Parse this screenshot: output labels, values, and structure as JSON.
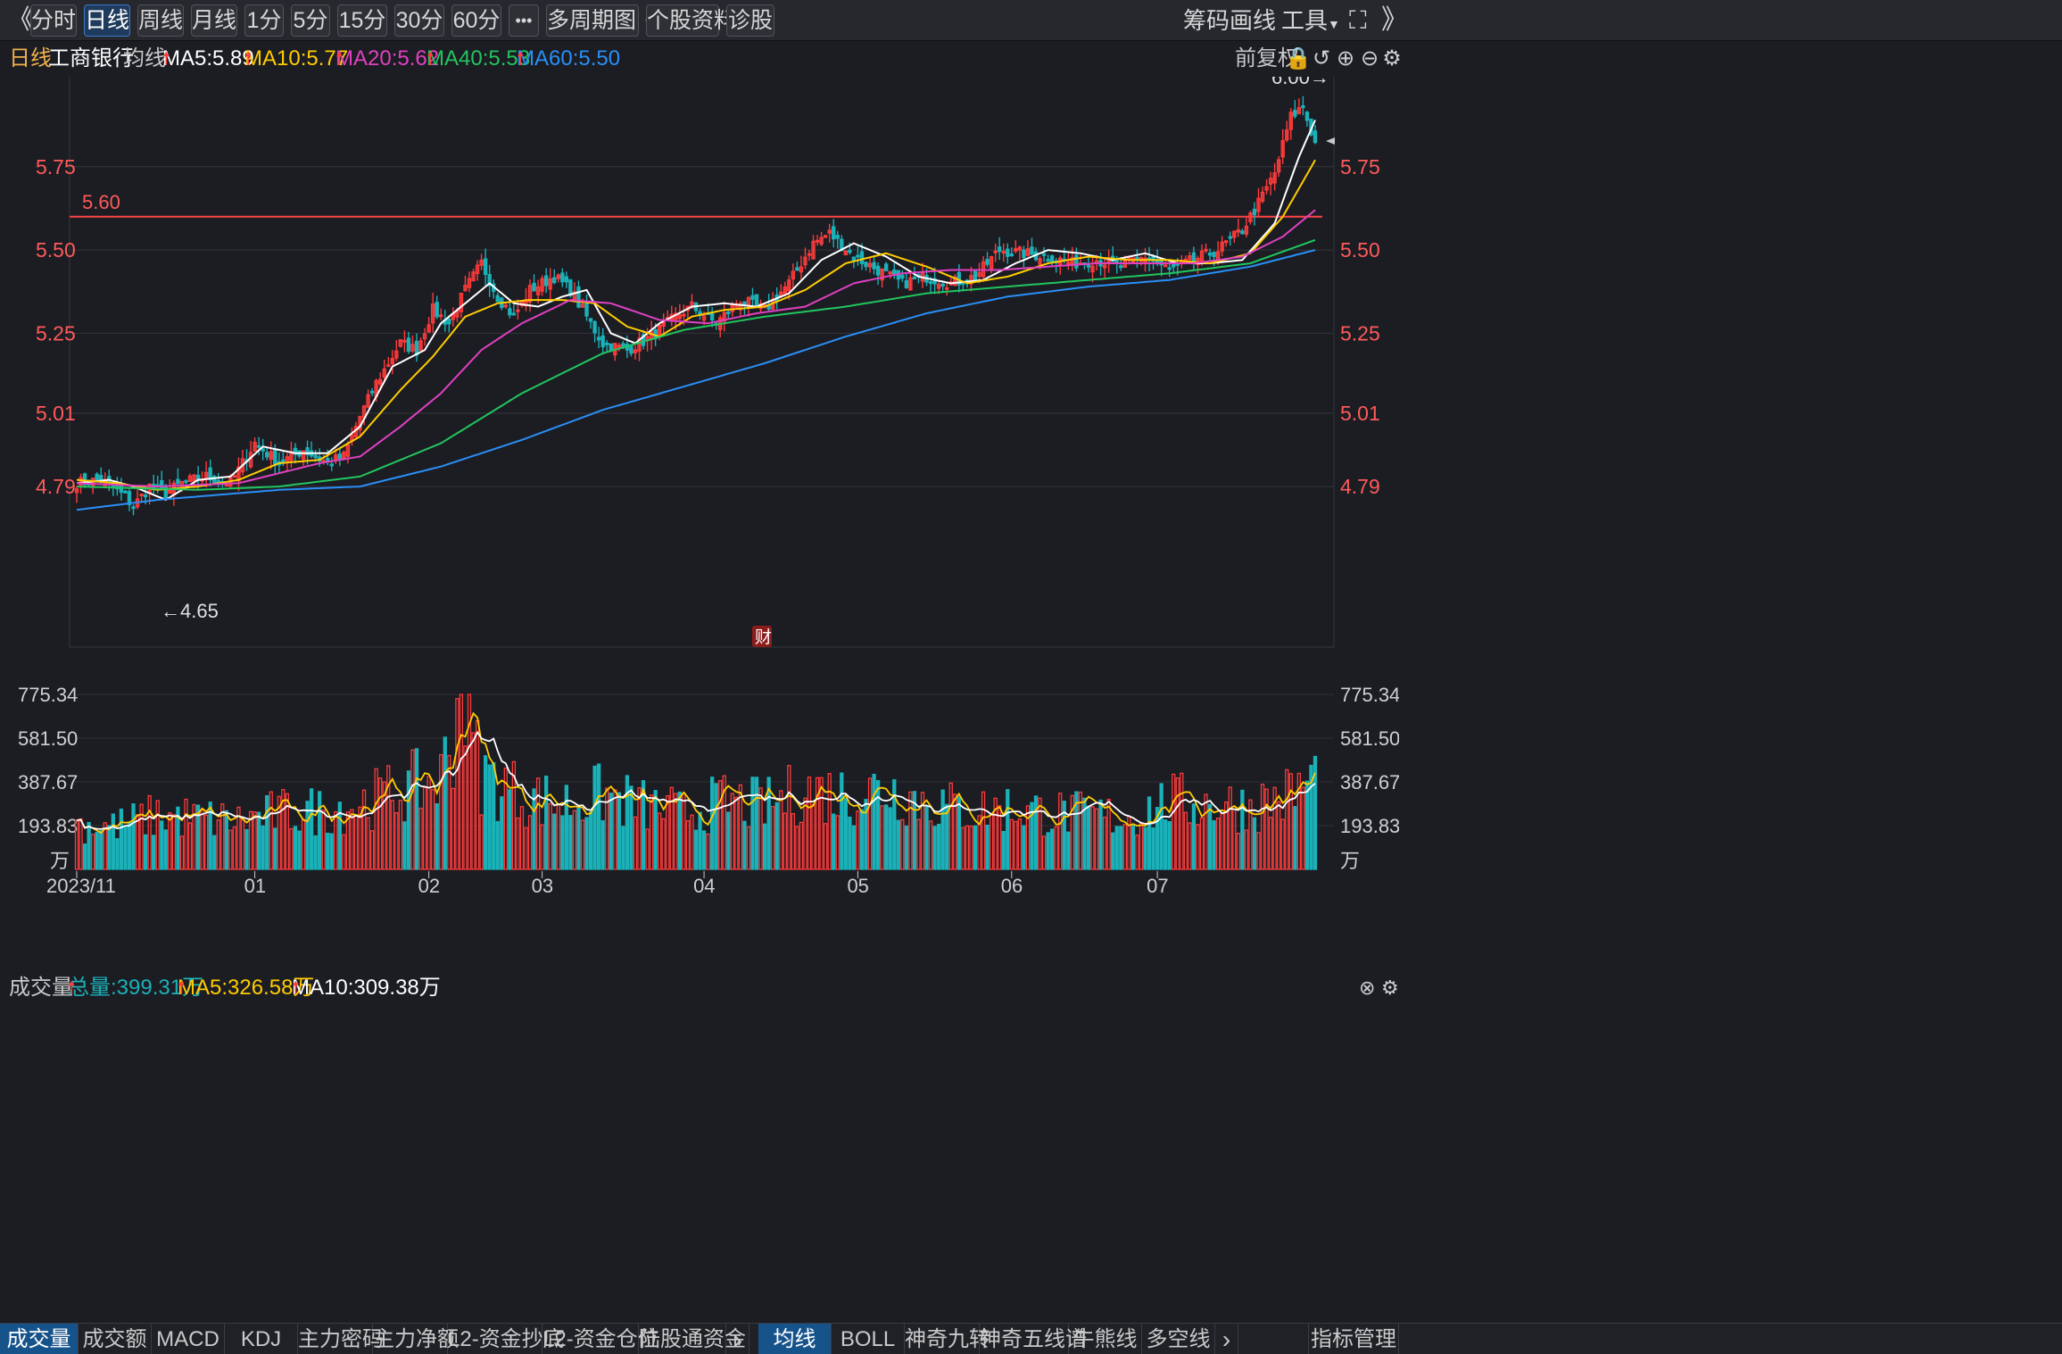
{
  "toolbar": {
    "collapse": "《",
    "expand": "》",
    "periods": [
      "分时",
      "日线",
      "周线",
      "月线",
      "1分",
      "5分",
      "15分",
      "30分",
      "60分"
    ],
    "active_period": "日线",
    "more": "•••",
    "multi_period": "多周期图",
    "profile": "个股资料",
    "diagnose": "诊股",
    "chips": "筹码",
    "draw": "画线",
    "tools": "工具"
  },
  "header": {
    "period": "日线",
    "stock_name": "工商银行",
    "ma_label": "均线",
    "ma5": "MA5:5.89",
    "ma10": "MA10:5.77",
    "ma20": "MA20:5.62",
    "ma40": "MA40:5.53",
    "ma60": "MA60:5.50",
    "adjust": "前复权"
  },
  "price_chart": {
    "y_labels": [
      "5.75",
      "5.50",
      "5.25",
      "5.01",
      "4.79"
    ],
    "ref_line": "5.60",
    "high_mark": "6.00→",
    "low_mark": "←4.65",
    "event_badge": "财"
  },
  "volume_header": {
    "title": "成交量",
    "total": "总量:399.31万",
    "ma5": "MA5:326.58万",
    "ma10": "MA10:309.38万"
  },
  "volume_chart": {
    "y_labels": [
      "775.34",
      "581.50",
      "387.67",
      "193.83"
    ],
    "unit": "万",
    "x_labels": [
      "2023/11",
      "01",
      "02",
      "03",
      "04",
      "05",
      "06",
      "07"
    ]
  },
  "bottom_tabs": {
    "left": [
      "成交量",
      "成交额",
      "MACD",
      "KDJ",
      "主力密码",
      "主力净额",
      "L2-资金抄底",
      "L2-资金仓位",
      "陆股通资金"
    ],
    "right": [
      "均线",
      "BOLL",
      "神奇九转",
      "神奇五线谱",
      "牛熊线",
      "多空线"
    ],
    "nav": "›",
    "manage": "指标管理"
  },
  "colors": {
    "up": "#ff3b3b",
    "down": "#1bb1b8",
    "ma5": "#ffffff",
    "ma10": "#ffcc00",
    "ma20": "#e040c0",
    "ma40": "#22c55e",
    "ma60": "#2a8ff7"
  },
  "chart_data": {
    "type": "candlestick",
    "title": "工商银行 日线",
    "x_start": "2023/11",
    "x_end": "2024/07",
    "y_range": [
      4.6,
      6.02
    ],
    "ref_line": 5.6,
    "series": [
      {
        "name": "MA5",
        "anchors": [
          [
            0,
            4.8
          ],
          [
            8,
            4.81
          ],
          [
            14,
            4.79
          ],
          [
            22,
            4.75
          ],
          [
            30,
            4.81
          ],
          [
            38,
            4.82
          ],
          [
            46,
            4.91
          ],
          [
            54,
            4.89
          ],
          [
            62,
            4.89
          ],
          [
            70,
            4.97
          ],
          [
            78,
            5.15
          ],
          [
            86,
            5.2
          ],
          [
            90,
            5.28
          ],
          [
            96,
            5.34
          ],
          [
            102,
            5.4
          ],
          [
            108,
            5.34
          ],
          [
            114,
            5.33
          ],
          [
            120,
            5.36
          ],
          [
            126,
            5.38
          ],
          [
            132,
            5.25
          ],
          [
            138,
            5.22
          ],
          [
            144,
            5.28
          ],
          [
            152,
            5.33
          ],
          [
            160,
            5.34
          ],
          [
            168,
            5.33
          ],
          [
            176,
            5.37
          ],
          [
            184,
            5.47
          ],
          [
            192,
            5.52
          ],
          [
            200,
            5.48
          ],
          [
            208,
            5.42
          ],
          [
            216,
            5.4
          ],
          [
            224,
            5.41
          ],
          [
            232,
            5.46
          ],
          [
            240,
            5.5
          ],
          [
            248,
            5.49
          ],
          [
            256,
            5.47
          ],
          [
            264,
            5.49
          ],
          [
            272,
            5.46
          ],
          [
            280,
            5.46
          ],
          [
            288,
            5.47
          ],
          [
            296,
            5.58
          ],
          [
            302,
            5.78
          ],
          [
            306,
            5.89
          ]
        ]
      },
      {
        "name": "MA10",
        "anchors": [
          [
            0,
            4.81
          ],
          [
            10,
            4.8
          ],
          [
            20,
            4.78
          ],
          [
            30,
            4.79
          ],
          [
            40,
            4.81
          ],
          [
            50,
            4.86
          ],
          [
            60,
            4.87
          ],
          [
            70,
            4.94
          ],
          [
            80,
            5.08
          ],
          [
            88,
            5.18
          ],
          [
            96,
            5.3
          ],
          [
            104,
            5.34
          ],
          [
            112,
            5.35
          ],
          [
            120,
            5.35
          ],
          [
            128,
            5.34
          ],
          [
            136,
            5.27
          ],
          [
            144,
            5.24
          ],
          [
            152,
            5.3
          ],
          [
            160,
            5.32
          ],
          [
            170,
            5.33
          ],
          [
            180,
            5.38
          ],
          [
            190,
            5.46
          ],
          [
            200,
            5.49
          ],
          [
            210,
            5.45
          ],
          [
            220,
            5.4
          ],
          [
            230,
            5.42
          ],
          [
            240,
            5.46
          ],
          [
            250,
            5.48
          ],
          [
            260,
            5.47
          ],
          [
            270,
            5.47
          ],
          [
            280,
            5.46
          ],
          [
            290,
            5.49
          ],
          [
            298,
            5.6
          ],
          [
            306,
            5.77
          ]
        ]
      },
      {
        "name": "MA20",
        "anchors": [
          [
            0,
            4.8
          ],
          [
            20,
            4.79
          ],
          [
            40,
            4.8
          ],
          [
            60,
            4.86
          ],
          [
            70,
            4.88
          ],
          [
            80,
            4.97
          ],
          [
            90,
            5.07
          ],
          [
            100,
            5.2
          ],
          [
            110,
            5.28
          ],
          [
            122,
            5.35
          ],
          [
            132,
            5.34
          ],
          [
            144,
            5.29
          ],
          [
            156,
            5.28
          ],
          [
            168,
            5.31
          ],
          [
            180,
            5.33
          ],
          [
            192,
            5.4
          ],
          [
            204,
            5.43
          ],
          [
            216,
            5.44
          ],
          [
            228,
            5.44
          ],
          [
            240,
            5.45
          ],
          [
            252,
            5.46
          ],
          [
            264,
            5.46
          ],
          [
            276,
            5.46
          ],
          [
            288,
            5.48
          ],
          [
            298,
            5.54
          ],
          [
            306,
            5.62
          ]
        ]
      },
      {
        "name": "MA40",
        "anchors": [
          [
            0,
            4.79
          ],
          [
            30,
            4.78
          ],
          [
            50,
            4.79
          ],
          [
            70,
            4.82
          ],
          [
            90,
            4.92
          ],
          [
            110,
            5.07
          ],
          [
            130,
            5.19
          ],
          [
            150,
            5.26
          ],
          [
            170,
            5.3
          ],
          [
            190,
            5.33
          ],
          [
            210,
            5.37
          ],
          [
            230,
            5.39
          ],
          [
            250,
            5.41
          ],
          [
            270,
            5.43
          ],
          [
            290,
            5.46
          ],
          [
            306,
            5.53
          ]
        ]
      },
      {
        "name": "MA60",
        "anchors": [
          [
            0,
            4.72
          ],
          [
            20,
            4.75
          ],
          [
            50,
            4.78
          ],
          [
            70,
            4.79
          ],
          [
            90,
            4.85
          ],
          [
            110,
            4.93
          ],
          [
            130,
            5.02
          ],
          [
            150,
            5.09
          ],
          [
            170,
            5.16
          ],
          [
            190,
            5.24
          ],
          [
            210,
            5.31
          ],
          [
            230,
            5.36
          ],
          [
            250,
            5.39
          ],
          [
            270,
            5.41
          ],
          [
            290,
            5.45
          ],
          [
            306,
            5.5
          ]
        ]
      }
    ],
    "close_anchors": [
      [
        0,
        4.8
      ],
      [
        6,
        4.81
      ],
      [
        12,
        4.76
      ],
      [
        14,
        4.73
      ],
      [
        18,
        4.79
      ],
      [
        22,
        4.77
      ],
      [
        26,
        4.8
      ],
      [
        32,
        4.82
      ],
      [
        38,
        4.8
      ],
      [
        44,
        4.92
      ],
      [
        50,
        4.86
      ],
      [
        56,
        4.9
      ],
      [
        62,
        4.86
      ],
      [
        66,
        4.88
      ],
      [
        70,
        5.0
      ],
      [
        74,
        5.1
      ],
      [
        80,
        5.22
      ],
      [
        84,
        5.2
      ],
      [
        88,
        5.32
      ],
      [
        92,
        5.28
      ],
      [
        96,
        5.38
      ],
      [
        100,
        5.46
      ],
      [
        104,
        5.36
      ],
      [
        108,
        5.3
      ],
      [
        112,
        5.38
      ],
      [
        118,
        5.42
      ],
      [
        122,
        5.38
      ],
      [
        126,
        5.3
      ],
      [
        130,
        5.22
      ],
      [
        136,
        5.2
      ],
      [
        142,
        5.24
      ],
      [
        148,
        5.3
      ],
      [
        152,
        5.33
      ],
      [
        158,
        5.28
      ],
      [
        164,
        5.35
      ],
      [
        170,
        5.32
      ],
      [
        176,
        5.4
      ],
      [
        182,
        5.52
      ],
      [
        186,
        5.55
      ],
      [
        192,
        5.48
      ],
      [
        198,
        5.44
      ],
      [
        204,
        5.4
      ],
      [
        210,
        5.42
      ],
      [
        216,
        5.4
      ],
      [
        222,
        5.42
      ],
      [
        228,
        5.5
      ],
      [
        234,
        5.49
      ],
      [
        240,
        5.48
      ],
      [
        246,
        5.46
      ],
      [
        252,
        5.47
      ],
      [
        258,
        5.45
      ],
      [
        264,
        5.48
      ],
      [
        270,
        5.44
      ],
      [
        276,
        5.47
      ],
      [
        282,
        5.5
      ],
      [
        288,
        5.56
      ],
      [
        292,
        5.64
      ],
      [
        296,
        5.73
      ],
      [
        300,
        5.9
      ],
      [
        303,
        5.93
      ],
      [
        306,
        5.82
      ]
    ],
    "candle_count": 307,
    "labeled_high": 6.0,
    "labeled_low": 4.65,
    "volume": {
      "unit": "万",
      "y_range": [
        0,
        775.34
      ],
      "ticks": [
        193.83,
        387.67,
        581.5,
        775.34
      ],
      "total": 399.31,
      "ma5": 326.58,
      "ma10": 309.38,
      "anchors": [
        [
          0,
          200
        ],
        [
          10,
          190
        ],
        [
          20,
          240
        ],
        [
          30,
          225
        ],
        [
          40,
          215
        ],
        [
          50,
          250
        ],
        [
          60,
          260
        ],
        [
          70,
          290
        ],
        [
          80,
          350
        ],
        [
          90,
          400
        ],
        [
          95,
          770
        ],
        [
          100,
          420
        ],
        [
          110,
          330
        ],
        [
          120,
          290
        ],
        [
          130,
          330
        ],
        [
          140,
          280
        ],
        [
          150,
          250
        ],
        [
          160,
          300
        ],
        [
          170,
          280
        ],
        [
          180,
          350
        ],
        [
          190,
          330
        ],
        [
          200,
          360
        ],
        [
          210,
          300
        ],
        [
          220,
          260
        ],
        [
          230,
          270
        ],
        [
          240,
          250
        ],
        [
          250,
          240
        ],
        [
          260,
          230
        ],
        [
          270,
          300
        ],
        [
          280,
          290
        ],
        [
          290,
          280
        ],
        [
          300,
          330
        ],
        [
          306,
          399
        ]
      ]
    }
  }
}
